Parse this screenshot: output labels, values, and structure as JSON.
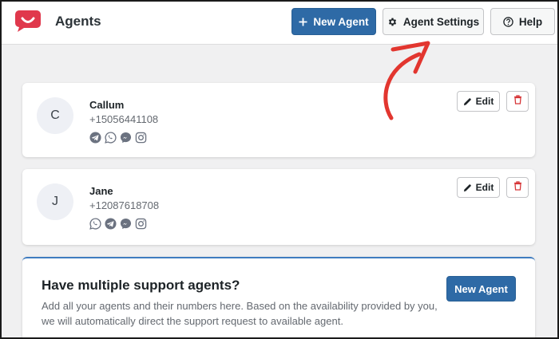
{
  "header": {
    "title": "Agents",
    "new_agent_label": "New Agent",
    "agent_settings_label": "Agent Settings",
    "help_label": "Help",
    "new_agent_icon": "plus-icon",
    "agent_settings_icon": "gear-icon",
    "help_icon": "question-circle-icon",
    "logo_color": "#e0384c"
  },
  "agents": [
    {
      "initial": "C",
      "name": "Callum",
      "phone": "+15056441108",
      "channels": [
        "telegram-icon",
        "whatsapp-icon",
        "messenger-icon",
        "instagram-icon"
      ],
      "edit_label": "Edit"
    },
    {
      "initial": "J",
      "name": "Jane",
      "phone": "+12087618708",
      "channels": [
        "whatsapp-icon",
        "telegram-icon",
        "messenger-icon",
        "instagram-icon"
      ],
      "edit_label": "Edit"
    }
  ],
  "promo": {
    "title": "Have multiple support agents?",
    "text": "Add all your agents and their numbers here. Based on the availability provided by you, we will automatically direct the support request to available agent.",
    "button_label": "New Agent"
  },
  "colors": {
    "primary": "#2e6aa6",
    "annotation_arrow": "#e2362f",
    "delete": "#d63638"
  }
}
